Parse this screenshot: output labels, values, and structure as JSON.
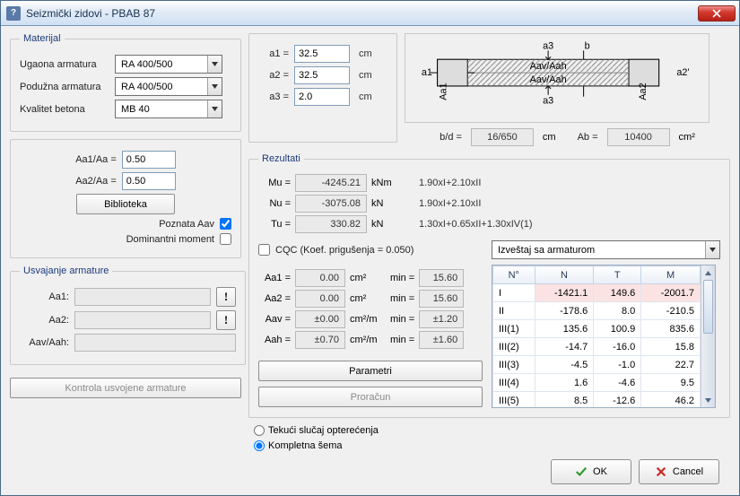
{
  "window": {
    "title": "Seizmički zidovi - PBAB 87"
  },
  "material": {
    "legend": "Materijal",
    "cornerRebarLabel": "Ugaona armatura",
    "cornerRebarValue": "RA 400/500",
    "longRebarLabel": "Podužna armatura",
    "longRebarValue": "RA 400/500",
    "concreteLabel": "Kvalitet betona",
    "concreteValue": "MB 40"
  },
  "geom": {
    "a1Label": "a1 =",
    "a1": "32.5",
    "a2Label": "a2 =",
    "a2": "32.5",
    "a3Label": "a3 =",
    "a3": "2.0",
    "cm": "cm"
  },
  "section": {
    "bdLabel": "b/d =",
    "bd": "16/650",
    "bdUnit": "cm",
    "AbLabel": "Ab =",
    "Ab": "10400",
    "AbUnit": "cm²",
    "diag": {
      "a1": "a1",
      "a2": "a2'",
      "a3top": "a3",
      "a3bot": "a3",
      "Aa1": "Aa1",
      "Aa2": "Aa2",
      "Aav": "Aav/Aah",
      "Aav2": "Aav/Aah",
      "b": "b"
    }
  },
  "ratios": {
    "Aa1Label": "Aa1/Aa =",
    "Aa1": "0.50",
    "Aa2Label": "Aa2/Aa =",
    "Aa2": "0.50",
    "libraryBtn": "Biblioteka",
    "knownAavLabel": "Poznata Aav",
    "dominantMomentLabel": "Dominantni moment"
  },
  "adopt": {
    "legend": "Usvajanje armature",
    "Aa1Label": "Aa1:",
    "Aa1": "",
    "Aa2Label": "Aa2:",
    "Aa2": "",
    "AavLabel": "Aav/Aah:",
    "Aav": ""
  },
  "controlBtn": "Kontrola usvojene armature",
  "results": {
    "legend": "Rezultati",
    "MuLabel": "Mu =",
    "Mu": "-4245.21",
    "MuUnit": "kNm",
    "MuCombo": "1.90xI+2.10xII",
    "NuLabel": "Nu =",
    "Nu": "-3075.08",
    "NuUnit": "kN",
    "NuCombo": "1.90xI+2.10xII",
    "TuLabel": "Tu =",
    "Tu": "330.82",
    "TuUnit": "kN",
    "TuCombo": "1.30xI+0.65xII+1.30xIV(1)",
    "cqcLabel": "CQC (Koef. prigušenja = 0.050)",
    "reportDropdown": "Izveštaj sa armaturom",
    "Aa1Label": "Aa1 =",
    "Aa1": "0.00",
    "Aa1Unit": "cm²",
    "min": "min =",
    "Aa1Min": "15.60",
    "Aa2Label": "Aa2 =",
    "Aa2": "0.00",
    "Aa2Unit": "cm²",
    "Aa2Min": "15.60",
    "AavLabel": "Aav =",
    "Aav": "±0.00",
    "AavUnit": "cm²/m",
    "AavMin": "±1.20",
    "AahLabel": "Aah =",
    "Aah": "±0.70",
    "AahUnit": "cm²/m",
    "AahMin": "±1.60",
    "paramBtn": "Parametri",
    "calcBtn": "Proračun"
  },
  "table": {
    "headers": [
      "N°",
      "N",
      "T",
      "M"
    ],
    "rows": [
      {
        "no": "I",
        "N": "-1421.1",
        "T": "149.6",
        "M": "-2001.7",
        "hl": true
      },
      {
        "no": "II",
        "N": "-178.6",
        "T": "8.0",
        "M": "-210.5"
      },
      {
        "no": "III(1)",
        "N": "135.6",
        "T": "100.9",
        "M": "835.6"
      },
      {
        "no": "III(2)",
        "N": "-14.7",
        "T": "-16.0",
        "M": "15.8"
      },
      {
        "no": "III(3)",
        "N": "-4.5",
        "T": "-1.0",
        "M": "22.7"
      },
      {
        "no": "III(4)",
        "N": "1.6",
        "T": "-4.6",
        "M": "9.5"
      },
      {
        "no": "III(5)",
        "N": "8.5",
        "T": "-12.6",
        "M": "46.2"
      }
    ]
  },
  "loadMode": {
    "currentLabel": "Tekući slučaj opterećenja",
    "completeLabel": "Kompletna šema"
  },
  "footer": {
    "ok": "OK",
    "cancel": "Cancel"
  }
}
